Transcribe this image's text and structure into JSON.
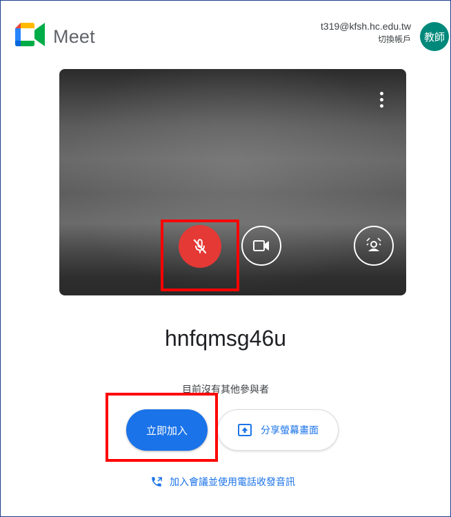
{
  "header": {
    "app_name": "Meet",
    "account_email": "t319@kfsh.hc.edu.tw",
    "switch_account_label": "切換帳戶",
    "avatar_text": "教師"
  },
  "preview": {
    "more_options_icon": "more-vert-icon",
    "mic_state": "off",
    "camera_state": "on",
    "colors": {
      "mic_off": "#e53935"
    }
  },
  "meeting": {
    "code": "hnfqmsg46u",
    "participants_status": "目前沒有其他參與者",
    "join_label": "立即加入",
    "present_label": "分享螢幕畫面",
    "phone_label": "加入會議並使用電話收發音訊"
  },
  "colors": {
    "accent": "#1a73e8",
    "annotation": "#ff0000",
    "avatar_bg": "#00897b"
  }
}
